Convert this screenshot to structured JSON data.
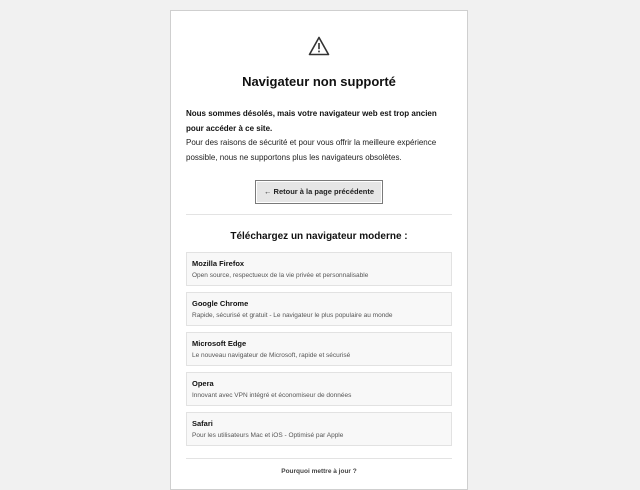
{
  "page": {
    "icon": "warning-triangle-icon",
    "title": "Navigateur non supporté",
    "intro_strong": "Nous sommes désolés, mais votre navigateur web est trop ancien pour accéder à ce site.",
    "intro_text": "Pour des raisons de sécurité et pour vous offrir la meilleure expérience possible, nous ne supportons plus les navigateurs obsolètes.",
    "back_label": "← Retour à la page précédente",
    "download_title": "Téléchargez un navigateur moderne :",
    "browsers": [
      {
        "name": "Mozilla Firefox",
        "desc": "Open source, respectueux de la vie privée et personnalisable"
      },
      {
        "name": "Google Chrome",
        "desc": "Rapide, sécurisé et gratuit - Le navigateur le plus populaire au monde"
      },
      {
        "name": "Microsoft Edge",
        "desc": "Le nouveau navigateur de Microsoft, rapide et sécurisé"
      },
      {
        "name": "Opera",
        "desc": "Innovant avec VPN intégré et économiseur de données"
      },
      {
        "name": "Safari",
        "desc": "Pour les utilisateurs Mac et iOS - Optimisé par Apple"
      }
    ],
    "why_title": "Pourquoi mettre à jour ?"
  },
  "colors": {
    "background": "#f1f1f1",
    "card": "#ffffff",
    "button": "#e6e6e6",
    "browser_card": "#f8f8f8"
  }
}
